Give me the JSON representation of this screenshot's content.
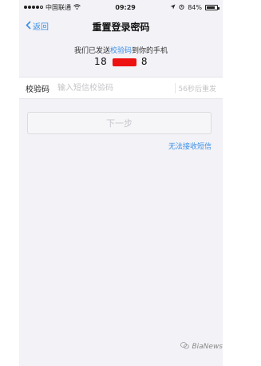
{
  "status_bar": {
    "carrier": "中国联通",
    "time": "09:29",
    "battery_text": "84%",
    "battery_level": 0.84
  },
  "nav": {
    "back_label": "返回",
    "title": "重置登录密码"
  },
  "info": {
    "prefix": "我们已发送",
    "highlight": "校验码",
    "suffix": "到你的手机",
    "phone_start": "18",
    "phone_end": "8",
    "highlight_color": "#3a8ee6"
  },
  "code": {
    "label": "校验码",
    "placeholder": "输入短信校验码",
    "resend": "56秒后重发"
  },
  "next_button": "下一步",
  "no_sms_link": "无法接收短信",
  "watermark": "BiaNews"
}
